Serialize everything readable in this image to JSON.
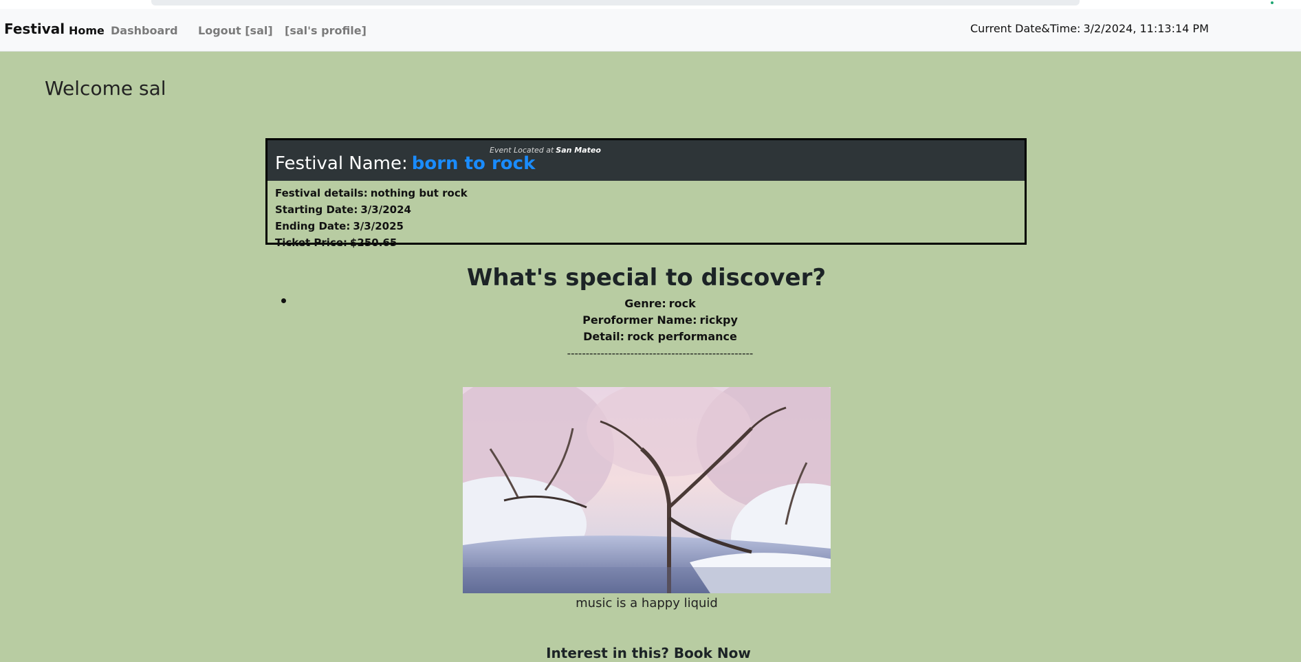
{
  "navbar": {
    "brand": "Festival",
    "links": [
      "Home",
      "Dashboard",
      "Logout [sal]",
      "[sal's profile]"
    ],
    "datetime_label": "Current Date&Time:",
    "datetime_value": "3/2/2024, 11:13:14 PM"
  },
  "welcome": "Welcome sal",
  "festival": {
    "name_label": "Festival Name:",
    "name": "born to rock",
    "location_label": "Event Located at",
    "location": "San Mateo",
    "details_label": "Festival details:",
    "details": "nothing but rock",
    "start_label": "Starting Date:",
    "start": "3/3/2024",
    "end_label": "Ending Date:",
    "end": "3/3/2025",
    "price_label": "Ticket Price:",
    "price": "$250.65"
  },
  "discover": {
    "heading": "What's special to discover?",
    "genre_label": "Genre:",
    "genre": "rock",
    "performer_label": "Peroformer Name:",
    "performer": "rickpy",
    "detail_label": "Detail:",
    "detail": "rock performance",
    "divider": "--------------------------------------------------"
  },
  "image": {
    "caption": "music is a happy liquid"
  },
  "book_now": "Interest in this? Book Now",
  "colors": {
    "page_bg": "#b8cca2",
    "card_header_bg": "#2e3538",
    "festival_name": "#1a8cff",
    "navbar_bg": "#f8f9fa"
  }
}
